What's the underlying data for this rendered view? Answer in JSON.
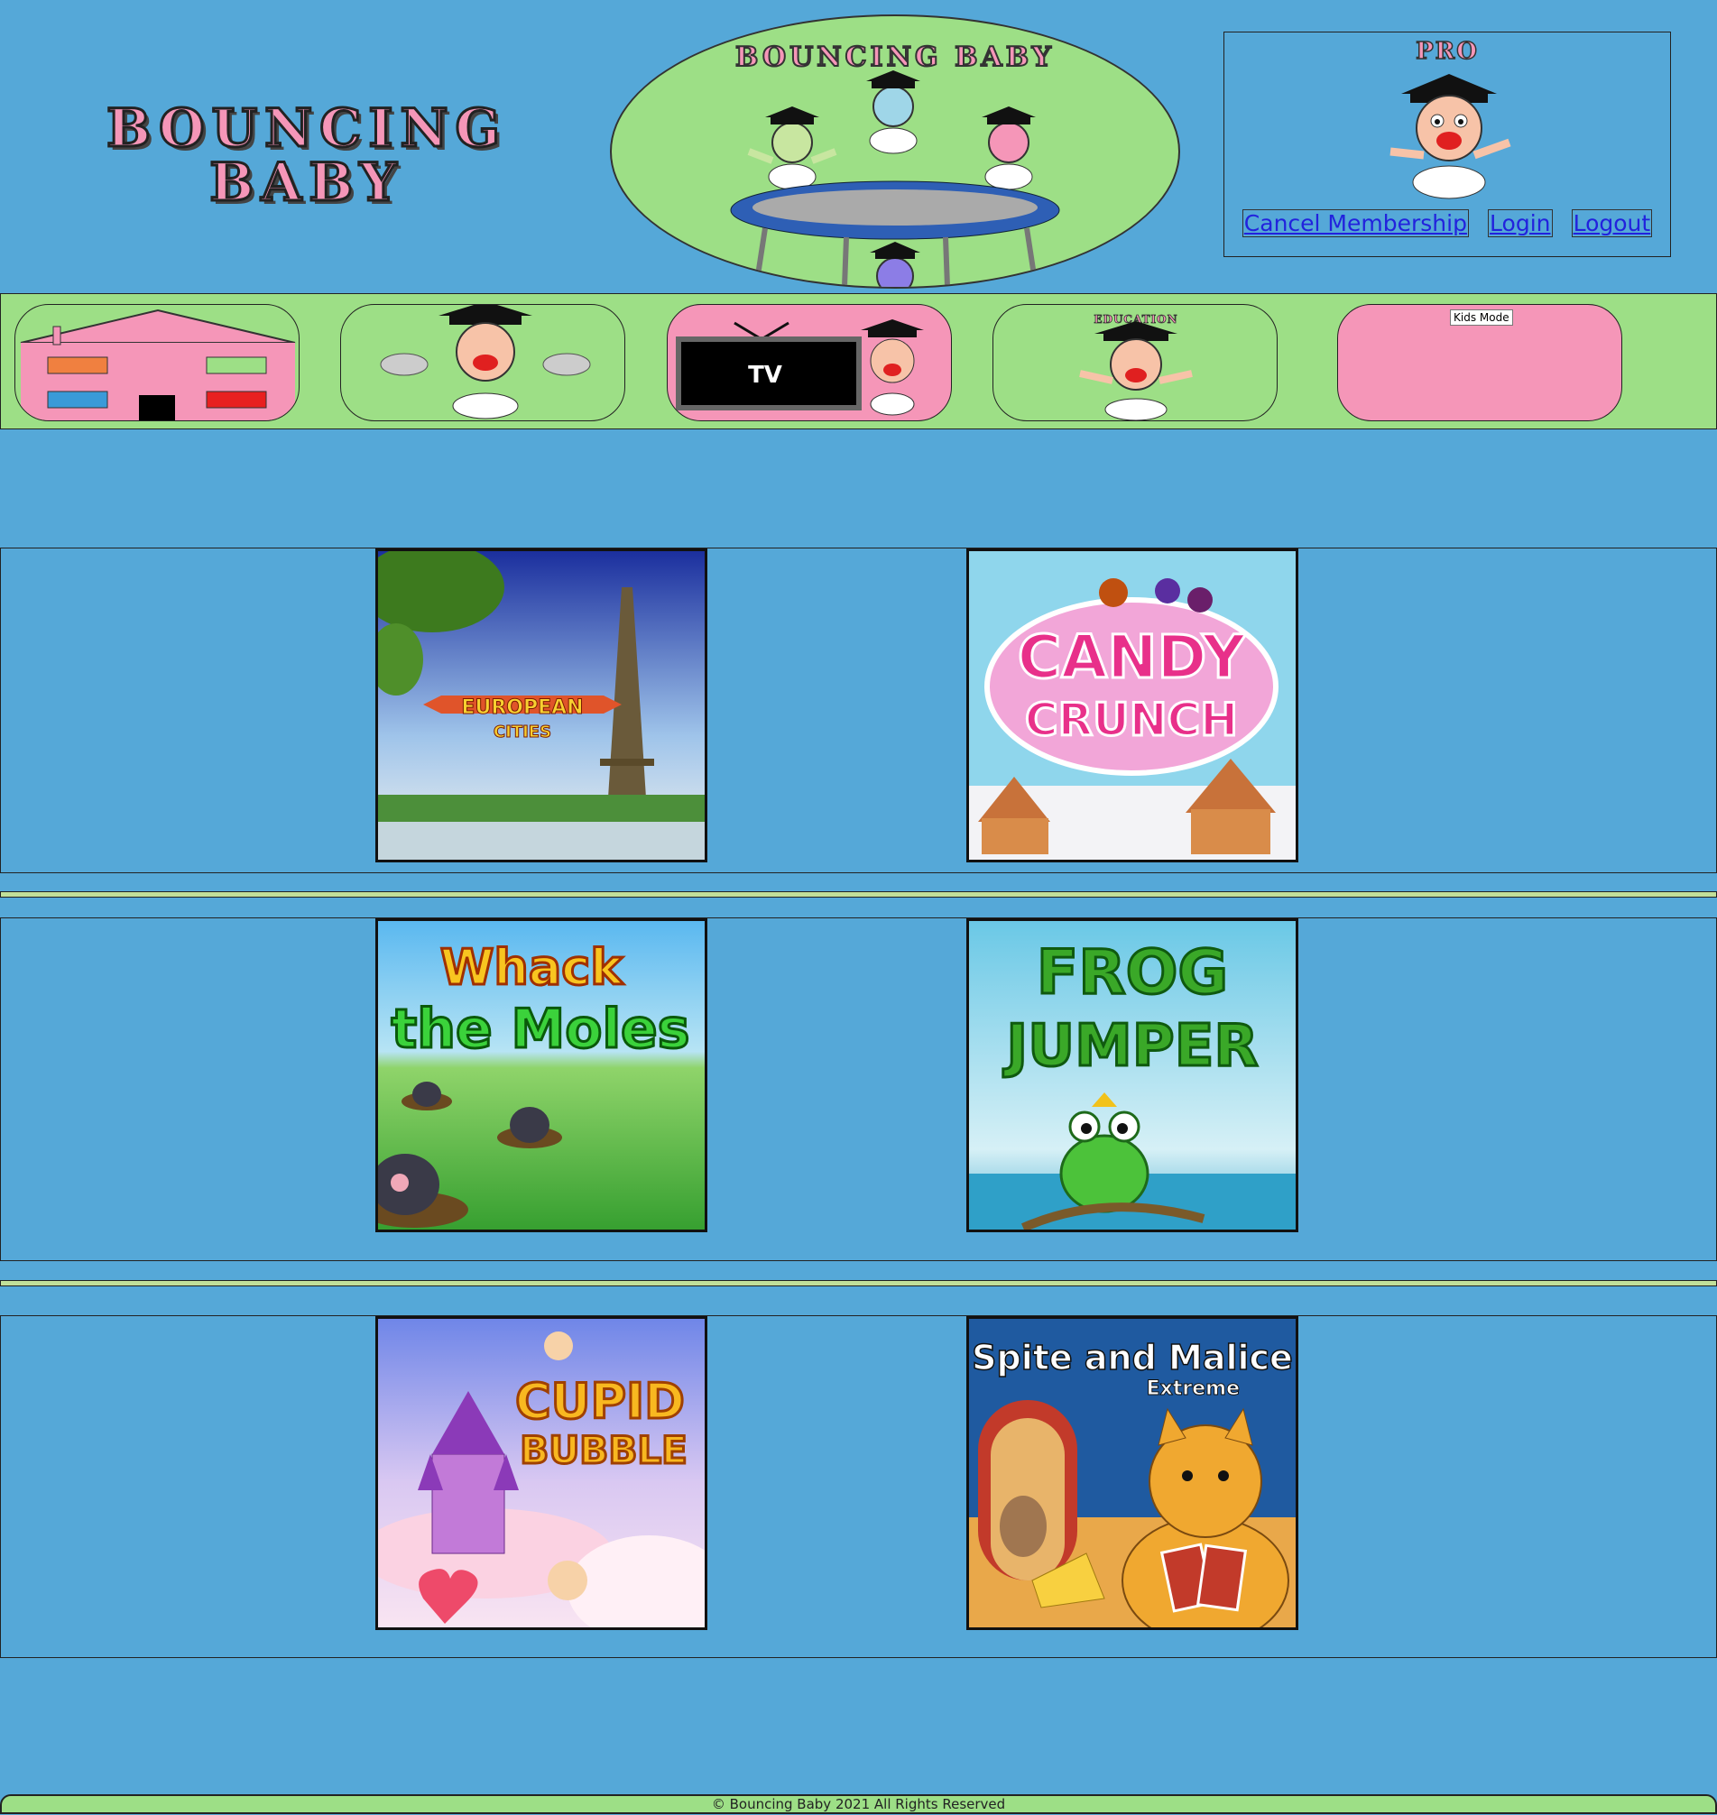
{
  "header": {
    "logo_text": "BOUNCING BABY",
    "banner_title": "BOUNCING BABY",
    "pro_badge": "PRO",
    "links": {
      "cancel_membership": "Cancel Membership",
      "login": "Login",
      "logout": "Logout"
    }
  },
  "nav": {
    "tv_label": "TV",
    "education_label": "EDUCATION",
    "kids_mode_label": "Kids Mode"
  },
  "games": {
    "european_cities": {
      "title_line1": "EUROPEAN",
      "title_line2": "CITIES"
    },
    "candy_crunch": {
      "title_line1": "CANDY",
      "title_line2": "CRUNCH"
    },
    "whack_the_moles": {
      "title_line1": "Whack",
      "title_line2": "the Moles"
    },
    "frog_jumper": {
      "title_line1": "FROG",
      "title_line2": "JUMPER"
    },
    "cupid_bubble": {
      "title_line1": "CUPID",
      "title_line2": "BUBBLE"
    },
    "spite_and_malice": {
      "title_line1": "Spite and Malice",
      "title_line2": "Extreme"
    }
  },
  "footer": {
    "copyright": "© Bouncing Baby 2021 All Rights Reserved"
  },
  "colors": {
    "page_background": "#55a8d8",
    "accent_green": "#9ddf86",
    "accent_pink": "#f596b8",
    "link_blue": "#2222dd"
  }
}
